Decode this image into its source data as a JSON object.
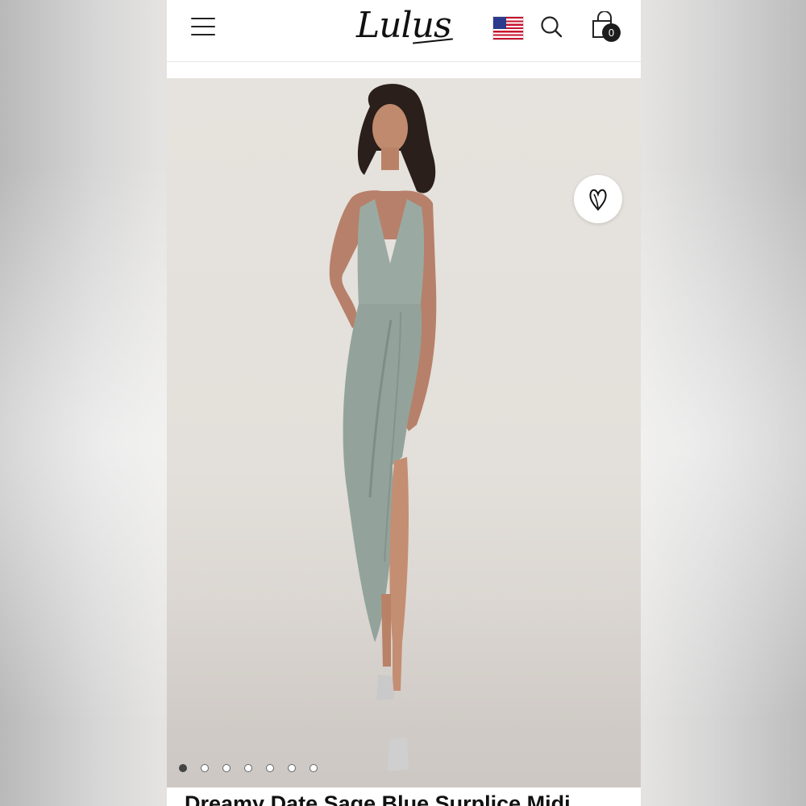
{
  "header": {
    "logo_text": "Lulus",
    "menu_icon": "hamburger-menu-icon",
    "country_flag": "us-flag-icon",
    "search_icon": "search-icon",
    "bag_icon": "shopping-bag-icon",
    "bag_count": "0"
  },
  "product": {
    "title": "Dreamy Date Sage Blue Surplice Midi",
    "wishlist_icon": "heart-icon",
    "dress_color": "#9aaaa2",
    "image_count": 7,
    "active_image_index": 0
  },
  "colors": {
    "accent": "#1c1c1c",
    "background": "#e6e2dd"
  }
}
